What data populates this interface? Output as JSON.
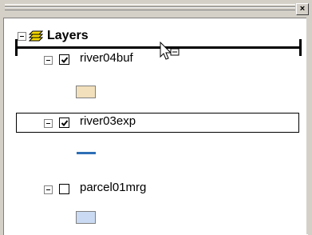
{
  "window": {
    "close_glyph": "×"
  },
  "toc": {
    "root": {
      "label": "Layers",
      "icon": "layers-icon"
    },
    "layers": [
      {
        "label": "river04buf",
        "checked": true,
        "symbol": "fill",
        "color": "#f2e0bc"
      },
      {
        "label": "river03exp",
        "checked": true,
        "symbol": "line",
        "color": "#2e6fb6"
      },
      {
        "label": "parcel01mrg",
        "checked": false,
        "symbol": "fill",
        "color": "#c9daf2"
      }
    ]
  },
  "cursor": {
    "icon": "move-cursor-icon"
  }
}
